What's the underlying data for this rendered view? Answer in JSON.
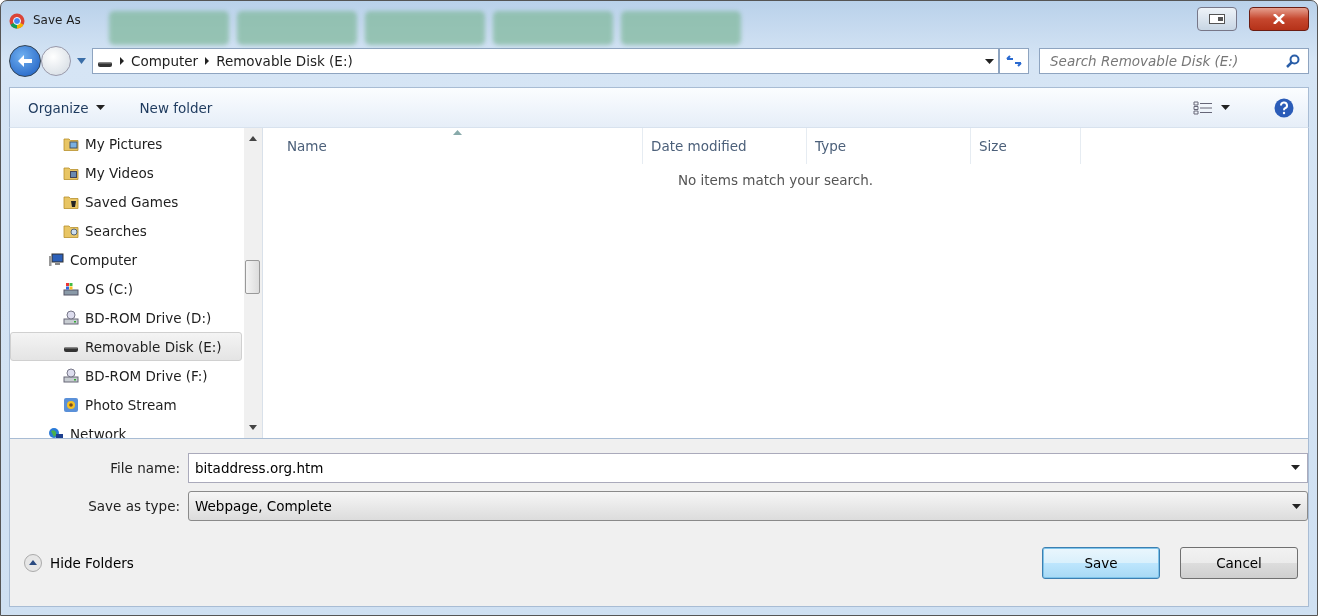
{
  "window": {
    "title": "Save As"
  },
  "address_bar": {
    "crumbs": [
      "Computer",
      "Removable Disk (E:)"
    ],
    "search_placeholder": "Search Removable Disk (E:)"
  },
  "toolbar": {
    "organize": "Organize",
    "new_folder": "New folder"
  },
  "nav_pane": {
    "continued_items": [
      {
        "label": "My Pictures",
        "kind": "pictures",
        "selected": false
      },
      {
        "label": "My Videos",
        "kind": "videos",
        "selected": false
      },
      {
        "label": "Saved Games",
        "kind": "games",
        "selected": false
      },
      {
        "label": "Searches",
        "kind": "searches",
        "selected": false
      }
    ],
    "tree": [
      {
        "label": "Computer",
        "kind": "computer",
        "selected": false,
        "children": [
          {
            "label": "OS (C:)",
            "kind": "os-drive",
            "selected": false
          },
          {
            "label": "BD-ROM Drive (D:)",
            "kind": "optical",
            "selected": false
          },
          {
            "label": "Removable Disk (E:)",
            "kind": "removable",
            "selected": true
          },
          {
            "label": "BD-ROM Drive (F:)",
            "kind": "optical",
            "selected": false
          },
          {
            "label": "Photo Stream",
            "kind": "photo",
            "selected": false
          }
        ]
      },
      {
        "label": "Network",
        "kind": "network",
        "selected": false
      }
    ]
  },
  "file_list": {
    "columns": [
      {
        "label": "Name",
        "sorted": true
      },
      {
        "label": "Date modified",
        "sorted": false
      },
      {
        "label": "Type",
        "sorted": false
      },
      {
        "label": "Size",
        "sorted": false
      }
    ],
    "empty_message": "No items match your search."
  },
  "form": {
    "file_name_label": "File name:",
    "file_name": "bitaddress.org.htm",
    "type_label": "Save as type:",
    "type": "Webpage, Complete"
  },
  "footer": {
    "hide_folders": "Hide Folders",
    "save": "Save",
    "cancel": "Cancel"
  }
}
